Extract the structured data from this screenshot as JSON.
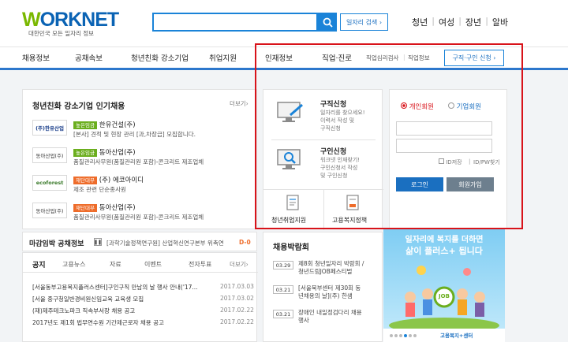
{
  "header": {
    "logo_text_w": "W",
    "logo_text_rest": "ORKNET",
    "logo_tagline": "대한민국 모든 일자리 정보",
    "search_placeholder": "",
    "job_search_label": "일자리 검색",
    "top_links": [
      "청년",
      "여성",
      "장년",
      "알바"
    ]
  },
  "gnb": {
    "items": [
      "채용정보",
      "공채속보",
      "청년친화 강소기업",
      "취업지원",
      "인재정보",
      "직업·진로"
    ],
    "sub_items": [
      "직업심리검사",
      "직업정보"
    ],
    "cta_label": "구직·구인 신청"
  },
  "companies_panel": {
    "title": "청년친화 강소기업 인기채용",
    "more_label": "더보기",
    "items": [
      {
        "logo": "(주)한유산업",
        "badge": "높은임금",
        "badge_color": "green",
        "name": "한유건설(주)",
        "desc": "[본사] 견적 및 현장 관리 [과,차장급] 모집합니다."
      },
      {
        "logo": "동아산업(주)",
        "badge": "높은임금",
        "badge_color": "green",
        "name": "동아산업(주)",
        "desc": "품질관리사무원(품질관리원 포함)-콘크리트 제조업체"
      },
      {
        "logo": "ecoforest",
        "badge": "재단대부",
        "badge_color": "orange",
        "name": "(주) 에코아이디",
        "desc": "제조 관련 단순종사원"
      },
      {
        "logo": "동아산업(주)",
        "badge": "재단대부",
        "badge_color": "orange",
        "name": "동아산업(주)",
        "desc": "품질관리사무원(품질관리원 포함)-콘크리트 제조업체"
      }
    ]
  },
  "mid_panel": {
    "job_apply_title": "구직신청",
    "job_apply_desc": [
      "일자리를 찾으세요!",
      "이력서 작성 및",
      "구직신청"
    ],
    "recruit_title": "구인신청",
    "recruit_desc": [
      "워크넷 인재찾기!",
      "구인신청서 작성",
      "및 구인신청"
    ],
    "youth_label": "청년취업지원",
    "welfare_label": "고용복지정책"
  },
  "login_panel": {
    "individual_label": "개인회원",
    "company_label": "기업회원",
    "save_id_label": "ID저장",
    "find_label": "ID/PW찾기",
    "login_label": "로그인",
    "join_label": "회원가입"
  },
  "deadline": {
    "title": "마감임박 공채정보",
    "pause_icon": "pause-icon",
    "text": "[과학기술정책연구원] 산업혁신연구본부 위촉연",
    "dday": "D-0"
  },
  "notice_panel": {
    "tabs": [
      "공지",
      "고용뉴스",
      "자료",
      "이벤트",
      "전자투표"
    ],
    "more_label": "더보기",
    "items": [
      {
        "title": "[서울동부고용복지플러스센터]구인구직 만남의 날 행사 안내('17...",
        "date": "2017.03.03"
      },
      {
        "title": "[서울 중구청일반경비원신임교육 교육생 모집",
        "date": "2017.03.02"
      },
      {
        "title": "(재)제주테크노파크 직속부서장 채용 공고",
        "date": "2017.02.22"
      },
      {
        "title": "2017년도 제1회 법무연수원 기간제근로자 채용 공고",
        "date": "2017.02.22"
      }
    ]
  },
  "fair_panel": {
    "title": "채용박람회",
    "items": [
      {
        "date": "03.29",
        "lines": [
          "제8회 청년일자리 박람회 /",
          "청년드림JOB페스티벌"
        ]
      },
      {
        "date": "03.21",
        "lines": [
          "[서울북부센터 제30회 동",
          "년채용의 날](주) 한샘"
        ]
      },
      {
        "date": "03.21",
        "lines": [
          "장애인 내일정검다리 채용",
          "행사"
        ]
      }
    ]
  },
  "banner": {
    "line1": "일자리에 복지를 더하면",
    "line2": "삶이 플러스+ 됩니다",
    "job_text": "JOB",
    "footer_logo": "고용복지+센터"
  },
  "colors": {
    "accent": "#1a83d8",
    "highlight_box": "#d8131a",
    "login_blue": "#1a6fc0",
    "join_gray": "#6d7f8e"
  }
}
